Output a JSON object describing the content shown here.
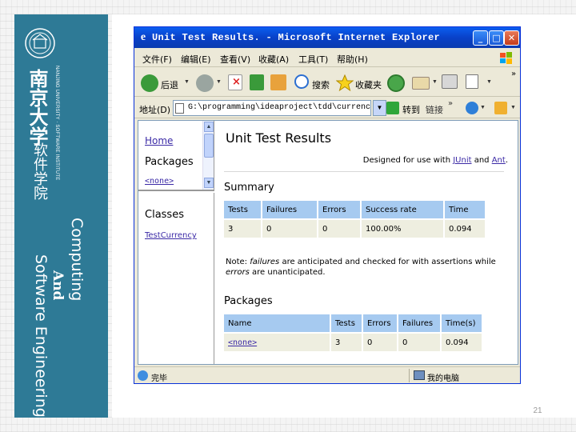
{
  "slide": {
    "cn_university": "南京大学",
    "en_university": "NANJING UNIVERSITY · SOFTWARE INSTITUTE",
    "cn_school": "软件学院",
    "side_computing": "Computing",
    "side_and": "And",
    "side_se": "Software Engineering",
    "page_number": "21",
    "colors": {
      "band": "#2e7a96",
      "accent_link": "#3b2aa6",
      "table_header": "#a6caf0",
      "table_cell": "#eeeee0"
    }
  },
  "browser": {
    "title": "Unit Test Results. - Microsoft Internet Explorer",
    "window_buttons": {
      "min": "_",
      "max": "□",
      "close": "✕"
    },
    "menu": [
      "文件(F)",
      "编辑(E)",
      "查看(V)",
      "收藏(A)",
      "工具(T)",
      "帮助(H)"
    ],
    "toolbar": {
      "back": "后退",
      "search": "搜索",
      "favorites": "收藏夹",
      "chevron": "»"
    },
    "address": {
      "label": "地址(D)",
      "value": "G:\\programming\\ideaproject\\tdd\\currency\\report",
      "go": "转到",
      "links": "链接",
      "chevron": "»"
    },
    "status": {
      "left": "完毕",
      "right": "我的电脑"
    }
  },
  "report": {
    "nav": {
      "home": "Home",
      "packages_heading": "Packages",
      "none_link": "<none>",
      "classes_heading": "Classes",
      "class_link": "TestCurrency"
    },
    "title": "Unit Test Results",
    "designed_prefix": "Designed for use with ",
    "designed_junit": "JUnit",
    "designed_and": " and ",
    "designed_ant": "Ant",
    "designed_suffix": ".",
    "summary_heading": "Summary",
    "summary": {
      "headers": [
        "Tests",
        "Failures",
        "Errors",
        "Success rate",
        "Time"
      ],
      "row": [
        "3",
        "0",
        "0",
        "100.00%",
        "0.094"
      ]
    },
    "note": {
      "prefix": "Note: ",
      "failures_word": "failures",
      "middle": " are anticipated and checked for with assertions while ",
      "errors_word": "errors",
      "suffix": " are unanticipated."
    },
    "packages_heading": "Packages",
    "packages": {
      "headers": [
        "Name",
        "Tests",
        "Errors",
        "Failures",
        "Time(s)"
      ],
      "row": [
        "<none>",
        "3",
        "0",
        "0",
        "0.094"
      ]
    }
  }
}
